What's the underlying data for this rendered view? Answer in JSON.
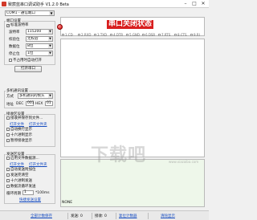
{
  "window": {
    "title": "致宸蓝串口调试助手 V1.2.0 Beta",
    "minimize": "–",
    "maximize": "□",
    "close": "✕"
  },
  "port": {
    "selected": "COM1 - 通信端口"
  },
  "port_settings": {
    "title": "端口设置",
    "std_baud_label": "标准波特率",
    "baud_label": "波特率",
    "baud_value": "115200",
    "parity_label": "校验位",
    "parity_value": "无校验",
    "data_bits_label": "数据位",
    "data_bits_value": "8位",
    "stop_bits_label": "停止位",
    "stop_bits_value": "1位",
    "no_restart_label": "不占用时自动打开",
    "open_button": "打开串口"
  },
  "multi": {
    "title": "多机通讯设置",
    "mode_label": "方式",
    "mode_value": "多机通讯的帧头",
    "address_label": "地址",
    "address_dec_label": "DEC",
    "address_dec_value": "001",
    "address_hex_label": "HEX",
    "address_hex_value": "01"
  },
  "receive": {
    "title": "接收区设置",
    "recv_to_file": "接收并保存到文件...",
    "open_file_link": "打开文件",
    "open_dir_link": "打开文件夹",
    "auto_wrap": "自动换行显示",
    "hex_display": "十六进制显示",
    "pause_display": "暂停接收显示"
  },
  "send": {
    "title": "发送区设置",
    "use_file": "启用文件数据源...",
    "open_file_link": "打开文件",
    "open_dir_link": "打开文件夹",
    "auto_append": "自动发送附加位",
    "clear_after_send": "发送完清空",
    "hex_send": "十六进制发送",
    "loop_send": "数据流循环发送",
    "period_label": "循环周期",
    "period_value": "1",
    "period_unit": "*100ms",
    "shortcut_link": "快捷发送设置"
  },
  "status": {
    "title": "串口关闭状态",
    "led_color": "#d00000"
  },
  "signals": [
    "1.CD",
    "2.RXD",
    "3.TXD",
    "4.DTR",
    "5.GND",
    "6.DSR",
    "7.RTS",
    "8.CTS",
    "9.RI"
  ],
  "watermark": {
    "main": "下载吧",
    "sub": "www.xiazaiba.com"
  },
  "encoding": "NONE",
  "statusbar": {
    "open_all_link": "全部计数保存",
    "send_label": "发送: 0",
    "recv_label": "接收: 0",
    "settings_link": "复位计数器",
    "clear_link": "清除显示"
  }
}
